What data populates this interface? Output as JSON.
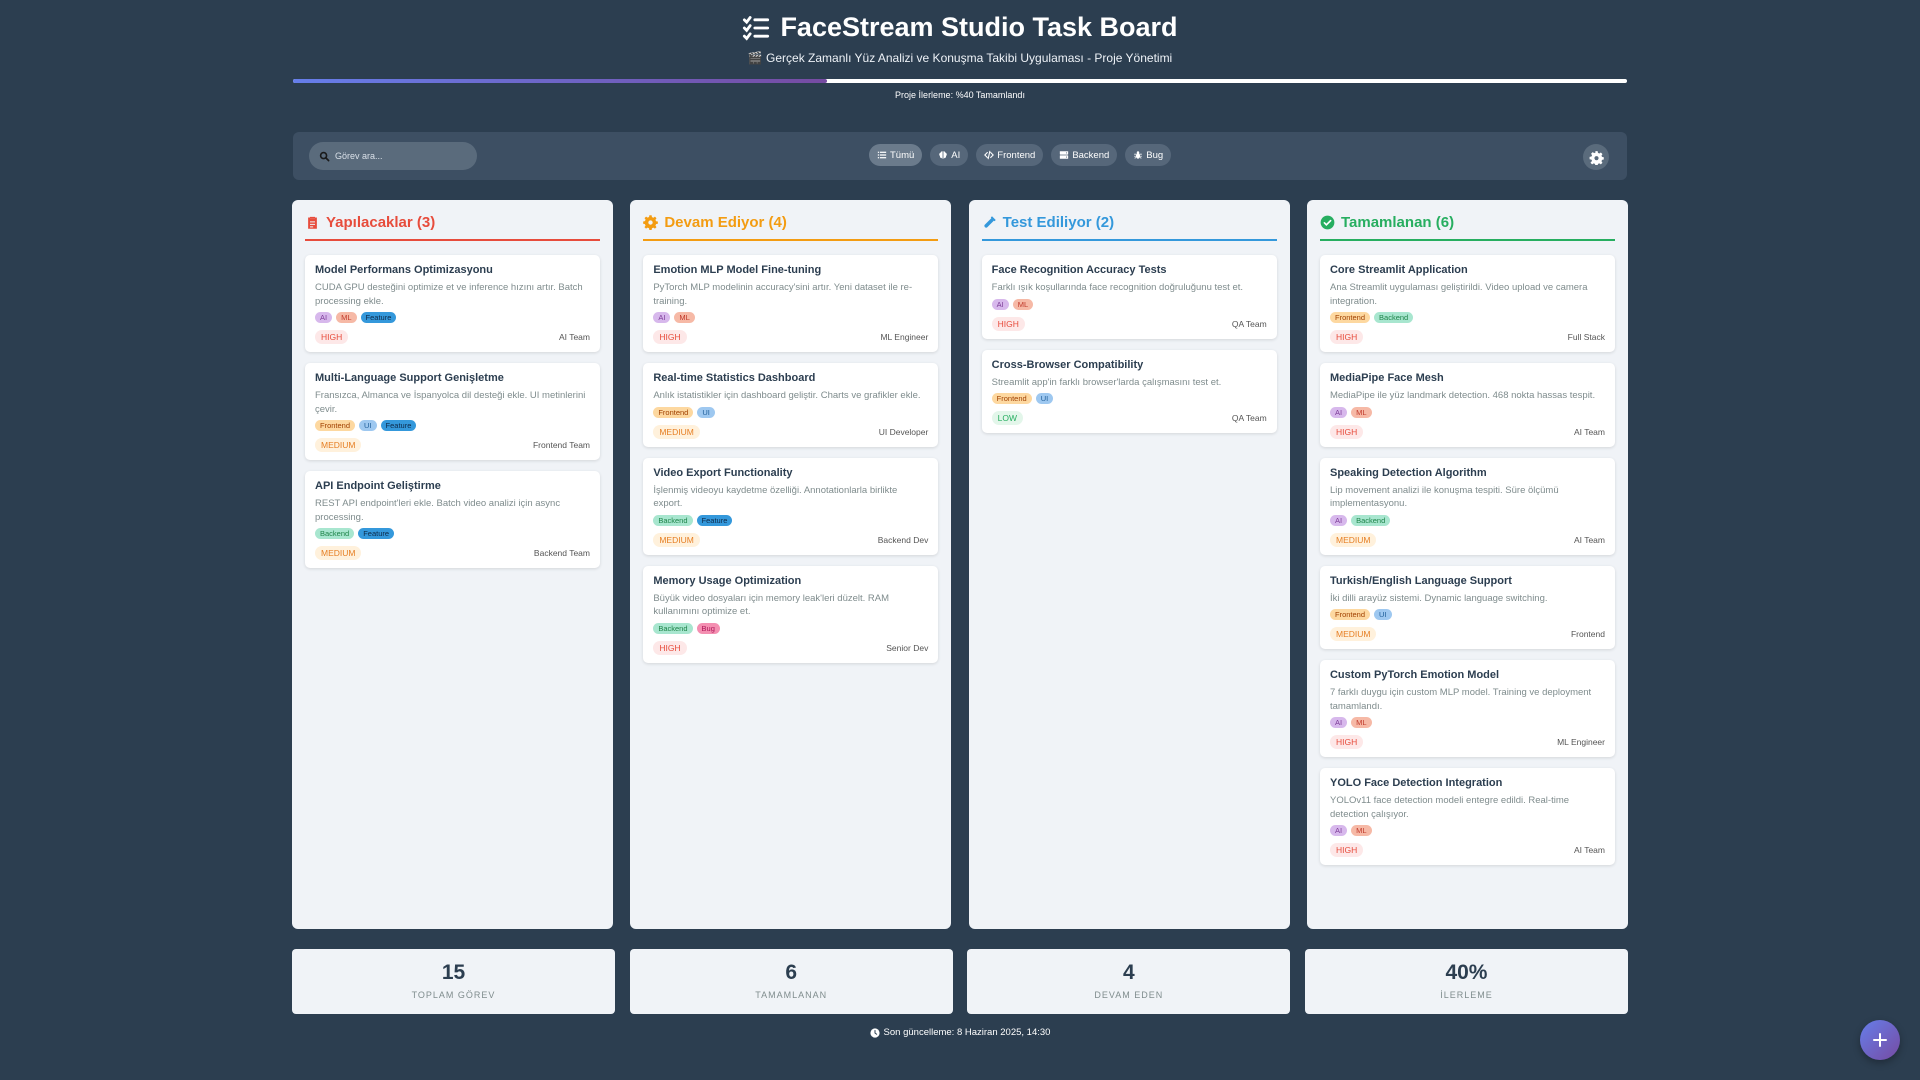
{
  "header": {
    "title": "FaceStream Studio Task Board",
    "subtitle": "🎬 Gerçek Zamanlı Yüz Analizi ve Konuşma Takibi Uygulaması - Proje Yönetimi",
    "progress_text": "Proje İlerleme: %40 Tamamlandı",
    "progress_fraction": 0.4
  },
  "toolbar": {
    "search_placeholder": "Görev ara...",
    "filters": [
      {
        "label": "Tümü",
        "icon": "list-icon"
      },
      {
        "label": "AI",
        "icon": "brain-icon"
      },
      {
        "label": "Frontend",
        "icon": "code-icon"
      },
      {
        "label": "Backend",
        "icon": "server-icon"
      },
      {
        "label": "Bug",
        "icon": "bug-icon"
      }
    ],
    "settings_icon": "gear-icon"
  },
  "columns": [
    {
      "title": "Yapılacaklar (3)",
      "icon": "clipboard-icon",
      "color": "#e74c3c",
      "cards": [
        {
          "title": "Model Performans Optimizasyonu",
          "desc": "CUDA GPU desteğini optimize et ve inference hızını artır. Batch processing ekle.",
          "tags": [
            "AI",
            "ML",
            "Feature"
          ],
          "priority": "HIGH",
          "assignee": "AI Team"
        },
        {
          "title": "Multi-Language Support Genişletme",
          "desc": "Fransızca, Almanca ve İspanyolca dil desteği ekle. UI metinlerini çevir.",
          "tags": [
            "Frontend",
            "UI",
            "Feature"
          ],
          "priority": "MEDIUM",
          "assignee": "Frontend Team"
        },
        {
          "title": "API Endpoint Geliştirme",
          "desc": "REST API endpoint'leri ekle. Batch video analizi için async processing.",
          "tags": [
            "Backend",
            "Feature"
          ],
          "priority": "MEDIUM",
          "assignee": "Backend Team"
        }
      ]
    },
    {
      "title": "Devam Ediyor (4)",
      "icon": "cog-icon",
      "color": "#f39c12",
      "cards": [
        {
          "title": "Emotion MLP Model Fine-tuning",
          "desc": "PyTorch MLP modelinin accuracy'sini artır. Yeni dataset ile re-training.",
          "tags": [
            "AI",
            "ML"
          ],
          "priority": "HIGH",
          "assignee": "ML Engineer"
        },
        {
          "title": "Real-time Statistics Dashboard",
          "desc": "Anlık istatistikler için dashboard geliştir. Charts ve grafikler ekle.",
          "tags": [
            "Frontend",
            "UI"
          ],
          "priority": "MEDIUM",
          "assignee": "UI Developer"
        },
        {
          "title": "Video Export Functionality",
          "desc": "İşlenmiş videoyu kaydetme özelliği. Annotationlarla birlikte export.",
          "tags": [
            "Backend",
            "Feature"
          ],
          "priority": "MEDIUM",
          "assignee": "Backend Dev"
        },
        {
          "title": "Memory Usage Optimization",
          "desc": "Büyük video dosyaları için memory leak'leri düzelt. RAM kullanımını optimize et.",
          "tags": [
            "Backend",
            "Bug"
          ],
          "priority": "HIGH",
          "assignee": "Senior Dev"
        }
      ]
    },
    {
      "title": "Test Ediliyor (2)",
      "icon": "flask-icon",
      "color": "#3498db",
      "cards": [
        {
          "title": "Face Recognition Accuracy Tests",
          "desc": "Farklı ışık koşullarında face recognition doğruluğunu test et.",
          "tags": [
            "AI",
            "ML"
          ],
          "priority": "HIGH",
          "assignee": "QA Team"
        },
        {
          "title": "Cross-Browser Compatibility",
          "desc": "Streamlit app'in farklı browser'larda çalışmasını test et.",
          "tags": [
            "Frontend",
            "UI"
          ],
          "priority": "LOW",
          "assignee": "QA Team"
        }
      ]
    },
    {
      "title": "Tamamlanan (6)",
      "icon": "check-circle-icon",
      "color": "#27ae60",
      "cards": [
        {
          "title": "Core Streamlit Application",
          "desc": "Ana Streamlit uygulaması geliştirildi. Video upload ve camera integration.",
          "tags": [
            "Frontend",
            "Backend"
          ],
          "priority": "HIGH",
          "assignee": "Full Stack"
        },
        {
          "title": "MediaPipe Face Mesh",
          "desc": "MediaPipe ile yüz landmark detection. 468 nokta hassas tespit.",
          "tags": [
            "AI",
            "ML"
          ],
          "priority": "HIGH",
          "assignee": "AI Team"
        },
        {
          "title": "Speaking Detection Algorithm",
          "desc": "Lip movement analizi ile konuşma tespiti. Süre ölçümü implementasyonu.",
          "tags": [
            "AI",
            "Backend"
          ],
          "priority": "MEDIUM",
          "assignee": "AI Team"
        },
        {
          "title": "Turkish/English Language Support",
          "desc": "İki dilli arayüz sistemi. Dynamic language switching.",
          "tags": [
            "Frontend",
            "UI"
          ],
          "priority": "MEDIUM",
          "assignee": "Frontend"
        },
        {
          "title": "Custom PyTorch Emotion Model",
          "desc": "7 farklı duygu için custom MLP model. Training ve deployment tamamlandı.",
          "tags": [
            "AI",
            "ML"
          ],
          "priority": "HIGH",
          "assignee": "ML Engineer"
        },
        {
          "title": "YOLO Face Detection Integration",
          "desc": "YOLOv11 face detection modeli entegre edildi. Real-time detection çalışıyor.",
          "tags": [
            "AI",
            "ML"
          ],
          "priority": "HIGH",
          "assignee": "AI Team"
        }
      ]
    }
  ],
  "stats": [
    {
      "value": "15",
      "label": "TOPLAM GÖREV"
    },
    {
      "value": "6",
      "label": "TAMAMLANAN"
    },
    {
      "value": "4",
      "label": "DEVAM EDEN"
    },
    {
      "value": "40%",
      "label": "İLERLEME"
    }
  ],
  "footer": {
    "text": "Son güncelleme: 8 Haziran 2025, 14:30",
    "icon": "clock-icon"
  },
  "fab": {
    "icon": "plus-icon"
  }
}
